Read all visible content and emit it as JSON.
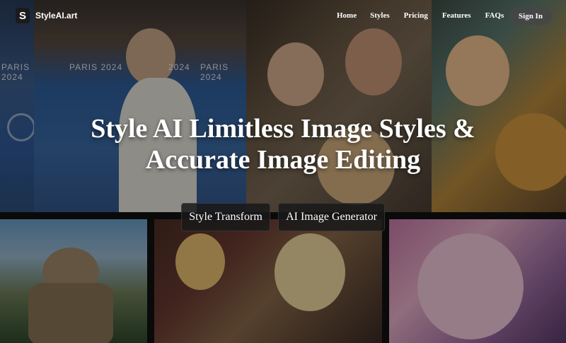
{
  "nav": {
    "brand_logo": "S",
    "brand_name": "StyleAI.art",
    "links": [
      "Home",
      "Styles",
      "Pricing",
      "Features",
      "FAQs"
    ],
    "signin_label": "Sign In"
  },
  "hero": {
    "title": "Style AI Limitless Image Styles & Accurate Image Editing",
    "buttons": [
      "Style Transform",
      "AI Image Generator"
    ]
  },
  "background": {
    "banner_text_1": "PARIS 2024",
    "banner_text_2": "PARIS 2024",
    "banner_text_3": "2024",
    "banner_text_4": "PARIS 2024"
  }
}
